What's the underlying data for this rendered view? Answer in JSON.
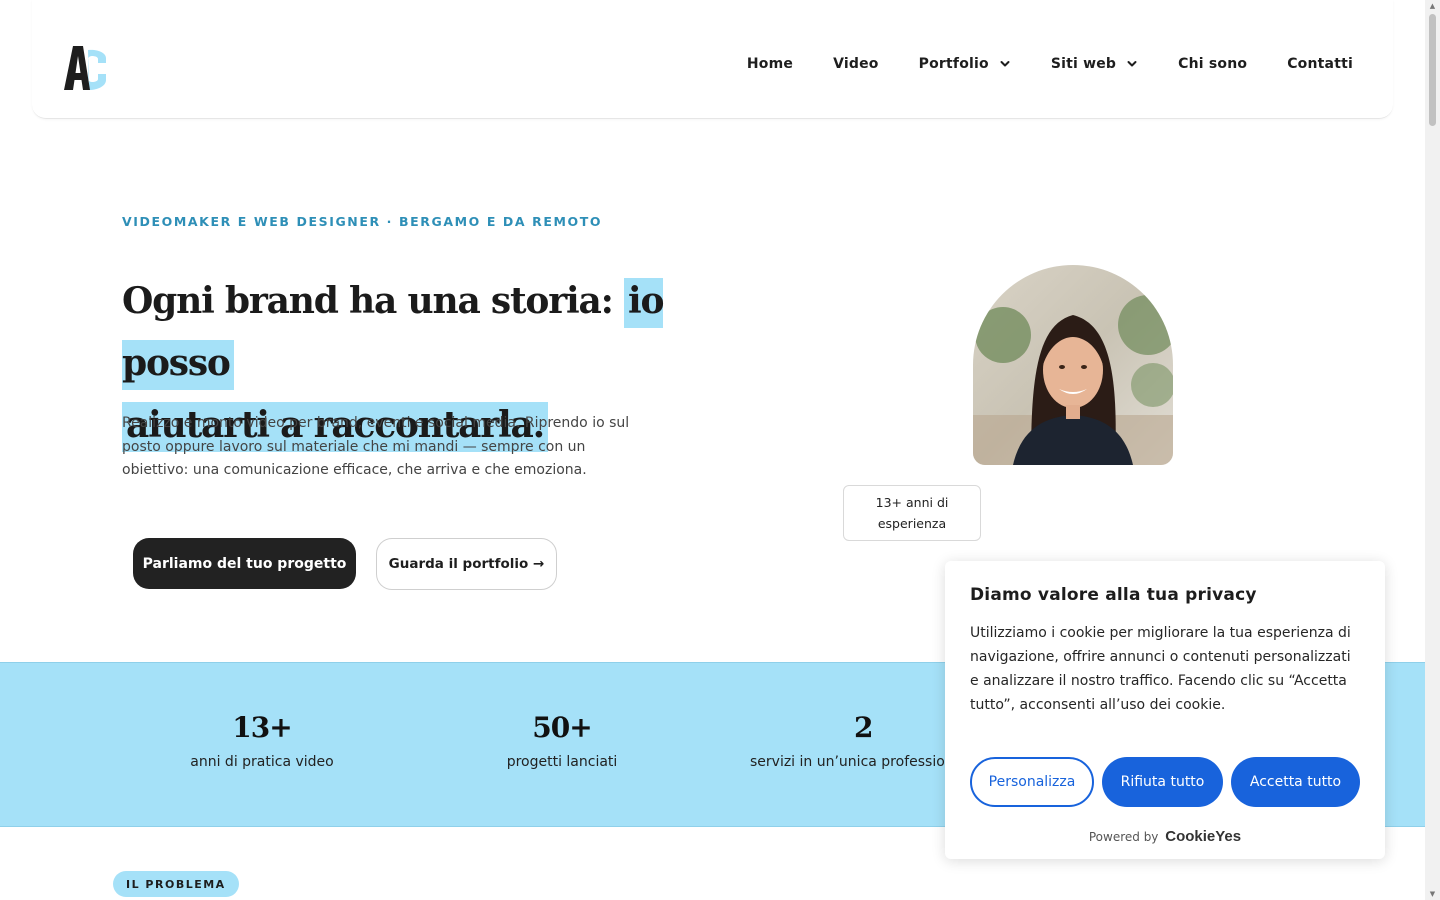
{
  "header": {
    "logo": {
      "letters": "AC",
      "colors": {
        "primary": "#1e1e1e",
        "accent": "#a5e1f8"
      }
    },
    "nav": [
      {
        "label": "Home",
        "dropdown": false
      },
      {
        "label": "Video",
        "dropdown": false
      },
      {
        "label": "Portfolio",
        "dropdown": true,
        "icon": "chevron-down-icon"
      },
      {
        "label": "Siti web",
        "dropdown": true,
        "icon": "chevron-down-icon"
      },
      {
        "label": "Chi sono",
        "dropdown": false
      },
      {
        "label": "Contatti",
        "dropdown": false
      }
    ]
  },
  "hero": {
    "eyebrow": "VIDEOMAKER E WEB DESIGNER · BERGAMO E DA REMOTO",
    "headline_plain": "Ogni brand ha una storia:",
    "headline_highlight_1": "io posso",
    "headline_highlight_2": "aiutarti a raccontarla.",
    "lede": "Realizzo e monto video per brand, eventi e social media. Riprendo io sul posto oppure lavoro sul materiale che mi mandi — sempre con un obiettivo: una comunicazione efficace, che arriva e che emoziona.",
    "cta_primary": "Parliamo del tuo progetto",
    "cta_secondary": "Guarda il portfolio →",
    "badge": "13+ anni di esperienza"
  },
  "stats": [
    {
      "number": "13+",
      "label": "anni di pratica video"
    },
    {
      "number": "50+",
      "label": "progetti lanciati"
    },
    {
      "number": "2",
      "label": "servizi in un’unica professionista"
    }
  ],
  "next_section": {
    "pill": "IL PROBLEMA"
  },
  "cookie_banner": {
    "title": "Diamo valore alla tua privacy",
    "text": "Utilizziamo i cookie per migliorare la tua esperienza di navigazione, offrire annunci o contenuti personalizzati e analizzare il nostro traffico. Facendo clic su “Accetta tutto”, acconsenti all’uso dei cookie.",
    "btn_customize": "Personalizza",
    "btn_reject": "Rifiuta tutto",
    "btn_accept": "Accetta tutto",
    "powered_by": "Powered by",
    "brand": "CookieYes"
  },
  "colors": {
    "accent_light_blue": "#a5e1f8",
    "eyebrow_blue": "#2e8fb7",
    "cookie_blue": "#1863dc",
    "dark": "#222222"
  }
}
